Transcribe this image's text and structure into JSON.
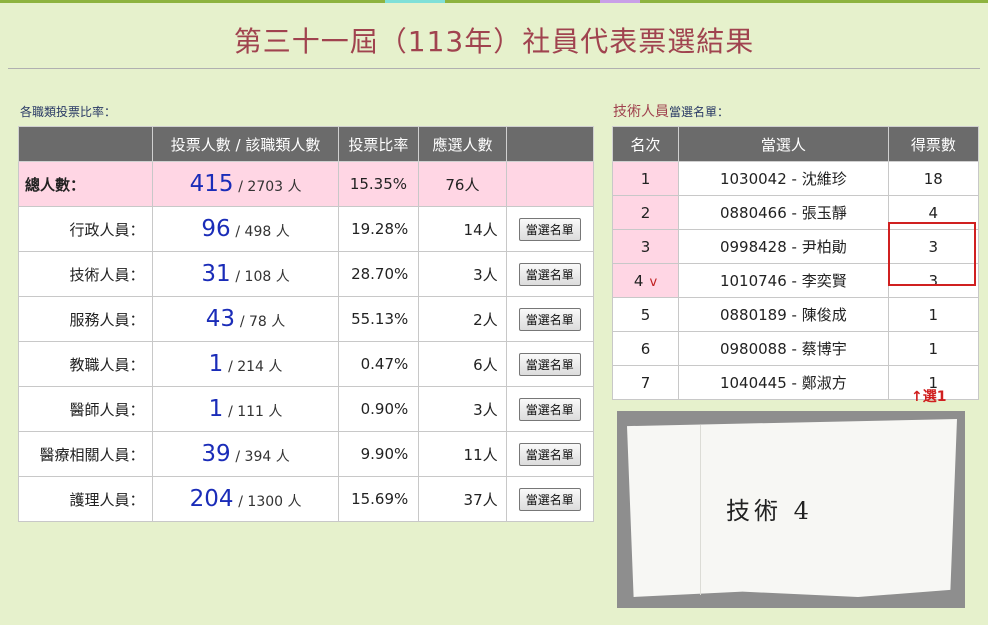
{
  "title": "第三十一屆（113年）社員代表票選結果",
  "votes_section": {
    "label": "各職類投票比率：",
    "headers": [
      "",
      "投票人數 / 該職類人數",
      "投票比率",
      "應選人數",
      ""
    ],
    "total": {
      "label": "總人數：",
      "voted": "415",
      "total": "/ 2703 人",
      "rate": "15.35%",
      "quota": "76人"
    },
    "rows": [
      {
        "label": "行政人員：",
        "voted": "96",
        "total": "/ 498 人",
        "rate": "19.28%",
        "quota": "14人",
        "button": "當選名單"
      },
      {
        "label": "技術人員：",
        "voted": "31",
        "total": "/ 108 人",
        "rate": "28.70%",
        "quota": "3人",
        "button": "當選名單"
      },
      {
        "label": "服務人員：",
        "voted": "43",
        "total": "/ 78 人",
        "rate": "55.13%",
        "quota": "2人",
        "button": "當選名單"
      },
      {
        "label": "教職人員：",
        "voted": "1",
        "total": "/ 214 人",
        "rate": "0.47%",
        "quota": "6人",
        "button": "當選名單"
      },
      {
        "label": "醫師人員：",
        "voted": "1",
        "total": "/ 111 人",
        "rate": "0.90%",
        "quota": "3人",
        "button": "當選名單"
      },
      {
        "label": "醫療相關人員：",
        "voted": "39",
        "total": "/ 394 人",
        "rate": "9.90%",
        "quota": "11人",
        "button": "當選名單"
      },
      {
        "label": "護理人員：",
        "voted": "204",
        "total": "/ 1300 人",
        "rate": "15.69%",
        "quota": "37人",
        "button": "當選名單"
      }
    ]
  },
  "winners_section": {
    "label_main": "技術人員",
    "label_sub": "當選名單：",
    "headers": [
      "名次",
      "當選人",
      "得票數"
    ],
    "rows": [
      {
        "rank": "1",
        "name": "1030042 - 沈維珍",
        "votes": "18"
      },
      {
        "rank": "2",
        "name": "0880466 - 張玉靜",
        "votes": "4"
      },
      {
        "rank": "3",
        "name": "0998428 - 尹柏勛",
        "votes": "3"
      },
      {
        "rank": "4",
        "mark": "v",
        "name": "1010746 - 李奕賢",
        "votes": "3"
      },
      {
        "rank": "5",
        "name": "0880189 - 陳俊成",
        "votes": "1"
      },
      {
        "rank": "6",
        "name": "0980088 - 蔡博宇",
        "votes": "1"
      },
      {
        "rank": "7",
        "name": "1040445 - 鄭淑方",
        "votes": "1"
      }
    ],
    "note": "↑選1"
  },
  "paper_note": "技術 4",
  "colors": {
    "accent": "#a0434f",
    "highlight_row": "#ffd6e4",
    "count_blue": "#1a2cb8",
    "box_red": "#d02020",
    "header_gray": "#6b6b6b"
  }
}
